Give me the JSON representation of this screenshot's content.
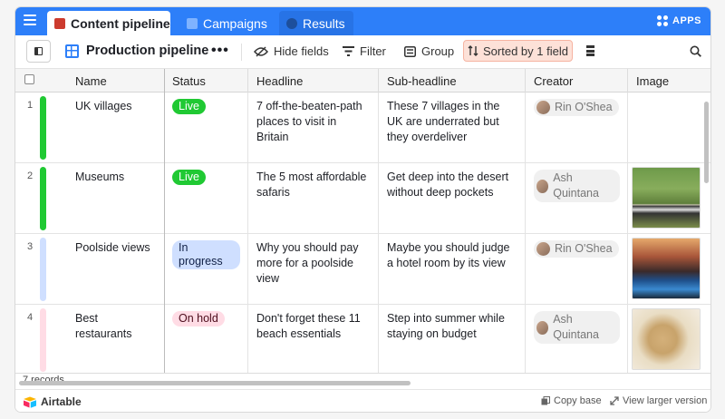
{
  "tabs": [
    {
      "label": "Content pipeline",
      "icon": "book-icon",
      "color": "#cc3b2e"
    },
    {
      "label": "Campaigns",
      "icon": "chart-icon",
      "color": "#7fb3ff"
    },
    {
      "label": "Results",
      "icon": "people-icon",
      "color": "#1d4f9c"
    }
  ],
  "apps_label": "APPS",
  "toolbar": {
    "view_name": "Production pipeline",
    "more": "•••",
    "hide_fields": "Hide fields",
    "filter": "Filter",
    "group": "Group",
    "sorted": "Sorted by 1 field"
  },
  "columns": [
    "Name",
    "Status",
    "Headline",
    "Sub-headline",
    "Creator",
    "Image"
  ],
  "rows": [
    {
      "num": "1",
      "name": "UK villages",
      "status": "Live",
      "headline": "7 off-the-beaten-path places to visit in Britain",
      "sub": "These 7 villages in the UK are underrated but they overdeliver",
      "creator": "Rin O'Shea",
      "image": "none"
    },
    {
      "num": "2",
      "name": "Museums",
      "status": "Live",
      "headline": "The 5 most affordable safaris",
      "sub": "Get deep into the desert without deep pockets",
      "creator": "Ash Quintana",
      "image": "zebras"
    },
    {
      "num": "3",
      "name": "Poolside views",
      "status": "In progress",
      "headline": "Why you should pay more for a poolside view",
      "sub": "Maybe you should judge a hotel room by its view",
      "creator": "Rin O'Shea",
      "image": "pool"
    },
    {
      "num": "4",
      "name": "Best restaurants",
      "status": "On hold",
      "headline": "Don't forget these 11 beach essentials",
      "sub": "Step into summer while staying on budget",
      "creator": "Ash Quintana",
      "image": "hat"
    }
  ],
  "status_colors": {
    "Live": {
      "bg": "#20c933",
      "fg": "#ffffff",
      "bar": "#20c933"
    },
    "In progress": {
      "bg": "#cfdfff",
      "fg": "#102046",
      "bar": "#cfdfff"
    },
    "On hold": {
      "bg": "#ffdce5",
      "fg": "#4c0c1c",
      "bar": "#ffdce5"
    }
  },
  "footer": {
    "records": "7 records",
    "brand": "Airtable",
    "copy_base": "Copy base",
    "view_larger": "View larger version"
  }
}
